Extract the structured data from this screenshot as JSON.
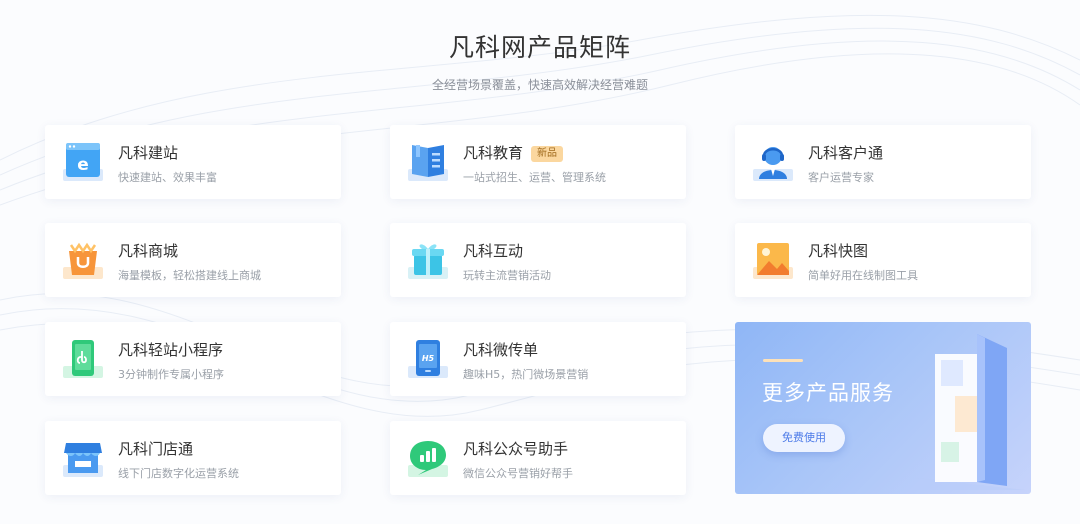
{
  "header": {
    "title": "凡科网产品矩阵",
    "subtitle": "全经营场景覆盖，快速高效解决经营难题"
  },
  "products": [
    {
      "name": "凡科建站",
      "desc": "快速建站、效果丰富",
      "icon": "website-icon"
    },
    {
      "name": "凡科教育",
      "desc": "一站式招生、运营、管理系统",
      "icon": "education-book-icon",
      "badge": "新品"
    },
    {
      "name": "凡科客户通",
      "desc": "客户运营专家",
      "icon": "customer-service-icon"
    },
    {
      "name": "凡科商城",
      "desc": "海量模板，轻松搭建线上商城",
      "icon": "shopping-bag-icon"
    },
    {
      "name": "凡科互动",
      "desc": "玩转主流营销活动",
      "icon": "gift-box-icon"
    },
    {
      "name": "凡科快图",
      "desc": "简单好用在线制图工具",
      "icon": "image-picture-icon"
    },
    {
      "name": "凡科轻站小程序",
      "desc": "3分钟制作专属小程序",
      "icon": "mini-program-icon"
    },
    {
      "name": "凡科微传单",
      "desc": "趣味H5，热门微场景营销",
      "icon": "h5-flyer-icon",
      "icon_text": "H5"
    },
    {
      "name": "凡科门店通",
      "desc": "线下门店数字化运营系统",
      "icon": "storefront-icon"
    },
    {
      "name": "凡科公众号助手",
      "desc": "微信公众号营销好帮手",
      "icon": "chat-bubble-chart-icon"
    }
  ],
  "promo": {
    "title": "更多产品服务",
    "button_label": "免费使用"
  },
  "colors": {
    "accent_blue": "#4d7be8",
    "badge_bg": "#fbd79f",
    "promo_gradient_start": "#8fb6f6",
    "promo_gradient_end": "#c6d3fb"
  }
}
